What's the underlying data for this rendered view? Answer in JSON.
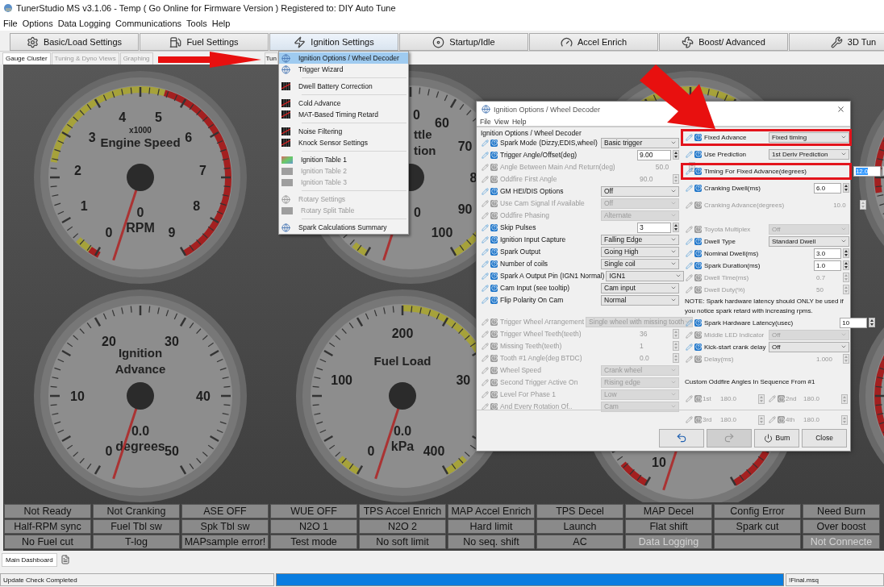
{
  "window": {
    "title": "TunerStudio MS v3.1.06 - Temp ( Go Online for Firmware Version ) Registered to: DIY Auto Tune"
  },
  "menu_bar": [
    "File",
    "Options",
    "Data Logging",
    "Communications",
    "Tools",
    "Help"
  ],
  "toolbar": [
    {
      "label": "Basic/Load Settings",
      "kind": "gear",
      "selected": false
    },
    {
      "label": "Fuel Settings",
      "kind": "fuel",
      "selected": false
    },
    {
      "label": "Ignition Settings",
      "kind": "spark",
      "selected": true
    },
    {
      "label": "Startup/Idle",
      "kind": "disc",
      "selected": false
    },
    {
      "label": "Accel Enrich",
      "kind": "accel",
      "selected": false
    },
    {
      "label": "Boost/ Advanced",
      "kind": "turbo",
      "selected": false
    },
    {
      "label": "3D Tun",
      "kind": "wrench",
      "selected": false
    }
  ],
  "view_tabs": [
    {
      "label": "Gauge Cluster",
      "selected": true,
      "disabled": false
    },
    {
      "label": "Tuning & Dyno Views",
      "selected": false,
      "disabled": true
    },
    {
      "label": "Graphing",
      "selected": false,
      "disabled": true
    },
    {
      "label": "Tun",
      "selected": false,
      "disabled": false
    }
  ],
  "gauges": [
    {
      "kind": "full",
      "multiplier": "x1000",
      "title": [
        "Engine Speed"
      ],
      "scale": [
        "0",
        "1",
        "2",
        "3",
        "4",
        "5",
        "6",
        "7",
        "8",
        "9"
      ],
      "value": "0",
      "unit": "RPM"
    },
    {
      "kind": "tail",
      "title": [
        "ttle",
        "tion"
      ],
      "scale": [
        "0",
        "60",
        "70",
        "8",
        "90",
        "100"
      ],
      "value": "0"
    },
    {
      "kind": "blank"
    },
    {
      "kind": "blank"
    },
    {
      "kind": "full",
      "title": [
        "Ignition",
        "Advance"
      ],
      "scale": [
        "0",
        "10",
        "20",
        "30",
        "40",
        "50"
      ],
      "value": "0.0",
      "unit": "degrees"
    },
    {
      "kind": "full",
      "title": [
        "Fuel Load"
      ],
      "scale": [
        "0",
        "100",
        "200",
        "30",
        "400"
      ],
      "value": "0.0",
      "unit": "kPa"
    },
    {
      "kind": "head",
      "scale": [
        "10"
      ]
    },
    {
      "kind": "blank"
    }
  ],
  "indicators": [
    {
      "kind": "text",
      "label": "Not Ready",
      "dim": false
    },
    {
      "kind": "text",
      "label": "Not Cranking",
      "dim": false
    },
    {
      "kind": "text",
      "label": "ASE OFF",
      "dim": false
    },
    {
      "kind": "text",
      "label": "WUE OFF",
      "dim": false
    },
    {
      "kind": "text",
      "label": "TPS Accel Enrich",
      "dim": false
    },
    {
      "kind": "text",
      "label": "MAP Accel Enrich",
      "dim": false
    },
    {
      "kind": "text",
      "label": "TPS Decel",
      "dim": false
    },
    {
      "kind": "text",
      "label": "MAP Decel",
      "dim": false
    },
    {
      "kind": "text",
      "label": "Config Error",
      "dim": false
    },
    {
      "kind": "text",
      "label": "Need Burn",
      "dim": false
    },
    {
      "kind": "text",
      "label": "Half-RPM sync",
      "dim": false
    },
    {
      "kind": "text",
      "label": "Fuel Tbl sw",
      "dim": false
    },
    {
      "kind": "text",
      "label": "Spk Tbl sw",
      "dim": false
    },
    {
      "kind": "text",
      "label": "N2O 1",
      "dim": false
    },
    {
      "kind": "text",
      "label": "N2O 2",
      "dim": false
    },
    {
      "kind": "text",
      "label": "Hard limit",
      "dim": false
    },
    {
      "kind": "text",
      "label": "Launch",
      "dim": false
    },
    {
      "kind": "text",
      "label": "Flat shift",
      "dim": false
    },
    {
      "kind": "text",
      "label": "Spark cut",
      "dim": false
    },
    {
      "kind": "text",
      "label": "Over boost",
      "dim": false
    },
    {
      "kind": "text",
      "label": "No Fuel cut",
      "dim": false
    },
    {
      "kind": "text",
      "label": "T-log",
      "dim": false
    },
    {
      "kind": "text",
      "label": "MAPsample error!",
      "dim": false
    },
    {
      "kind": "text",
      "label": "Test mode",
      "dim": false
    },
    {
      "kind": "text",
      "label": "No soft limit",
      "dim": false
    },
    {
      "kind": "text",
      "label": "No seq. shift",
      "dim": false
    },
    {
      "kind": "text",
      "label": "AC",
      "dim": false
    },
    {
      "kind": "text",
      "label": "Data Logging",
      "dim": true
    },
    {
      "kind": "blank"
    },
    {
      "kind": "text",
      "label": "Not Connecte",
      "dim": true
    }
  ],
  "bottom_tabs": [
    {
      "label": "Main Dashboard",
      "selected": true
    }
  ],
  "status_bar": {
    "message": "Update Check Completed",
    "progress": {
      "level": 1
    },
    "file": "!Final.msq"
  },
  "ignition_menu": {
    "groups": [
      [
        {
          "label": "Ignition Options / Wheel Decoder",
          "kind": "wizard",
          "selected": true,
          "disabled": false
        },
        {
          "label": "Trigger Wizard",
          "kind": "wizard",
          "selected": false,
          "disabled": false
        }
      ],
      [
        {
          "label": "Dwell Battery Correction",
          "kind": "grid",
          "selected": false,
          "disabled": false
        }
      ],
      [
        {
          "label": "Cold Advance",
          "kind": "grid",
          "selected": false,
          "disabled": false
        },
        {
          "label": "MAT-Based Timing Retard",
          "kind": "grid",
          "selected": false,
          "disabled": false
        }
      ],
      [
        {
          "label": "Noise Filtering",
          "kind": "grid",
          "selected": false,
          "disabled": false
        },
        {
          "label": "Knock Sensor Settings",
          "kind": "grid",
          "selected": false,
          "disabled": false
        }
      ],
      [
        {
          "label": "Ignition Table 1",
          "kind": "table",
          "selected": false,
          "disabled": false
        },
        {
          "label": "Ignition Table 2",
          "kind": "table",
          "selected": false,
          "disabled": true
        },
        {
          "label": "Ignition Table 3",
          "kind": "table",
          "selected": false,
          "disabled": true
        }
      ],
      [
        {
          "label": "Rotary Settings",
          "kind": "wizard",
          "selected": false,
          "disabled": true
        },
        {
          "label": "Rotary Split Table",
          "kind": "table",
          "selected": false,
          "disabled": true
        }
      ],
      [
        {
          "label": "Spark Calculations Summary",
          "kind": "wizard",
          "selected": false,
          "disabled": false
        }
      ]
    ]
  },
  "dialog": {
    "title": "Ignition Options / Wheel Decoder",
    "menu": [
      "File",
      "View",
      "Help"
    ],
    "left": [
      {
        "kind": "heading",
        "text": "Ignition Options / Wheel Decoder"
      },
      {
        "kind": "rows",
        "rows": [
          {
            "label": "Spark Mode (Dizzy,EDIS,wheel)",
            "disabled": false,
            "control": {
              "kind": "select",
              "value": "Basic trigger"
            }
          },
          {
            "label": "Trigger Angle/Offset(deg)",
            "disabled": false,
            "control": {
              "kind": "spin",
              "value": "9.00"
            }
          },
          {
            "label": "Angle Between Main And Return(deg)",
            "disabled": true,
            "control": {
              "kind": "readout",
              "value": "50.0"
            }
          },
          {
            "label": "Oddfire First Angle",
            "disabled": true,
            "control": {
              "kind": "readout",
              "value": "90.0"
            }
          },
          {
            "label": "GM HEI/DIS Options",
            "disabled": false,
            "control": {
              "kind": "select",
              "value": "Off"
            }
          },
          {
            "label": "Use Cam Signal If Available",
            "disabled": true,
            "control": {
              "kind": "select",
              "value": "Off"
            }
          },
          {
            "label": "Oddfire Phasing",
            "disabled": true,
            "control": {
              "kind": "select",
              "value": "Alternate"
            }
          },
          {
            "label": "Skip Pulses",
            "disabled": false,
            "control": {
              "kind": "spin",
              "value": "3"
            }
          },
          {
            "label": "Ignition Input Capture",
            "disabled": false,
            "control": {
              "kind": "select",
              "value": "Falling Edge"
            }
          },
          {
            "label": "Spark Output",
            "disabled": false,
            "control": {
              "kind": "select",
              "value": "Going High"
            }
          },
          {
            "label": "Number of coils",
            "disabled": false,
            "control": {
              "kind": "select",
              "value": "Single coil"
            }
          },
          {
            "label": "Spark A Output Pin (IGN1 Normal)",
            "disabled": false,
            "control": {
              "kind": "select",
              "value": "IGN1"
            }
          },
          {
            "label": "Cam Input (see tooltip)",
            "disabled": false,
            "control": {
              "kind": "select",
              "value": "Cam input"
            }
          },
          {
            "label": "Flip Polarity On Cam",
            "disabled": false,
            "control": {
              "kind": "select",
              "value": "Normal"
            }
          }
        ]
      },
      {
        "kind": "rows",
        "rows": [
          {
            "label": "Trigger Wheel Arrangement",
            "disabled": true,
            "control": {
              "kind": "wide_select",
              "value": "Single wheel with missing tooth"
            }
          },
          {
            "label": "Trigger Wheel Teeth(teeth)",
            "disabled": true,
            "control": {
              "kind": "readout",
              "value": "36"
            }
          },
          {
            "label": "Missing Teeth(teeth)",
            "disabled": true,
            "control": {
              "kind": "readout",
              "value": "1"
            }
          },
          {
            "label": "Tooth #1 Angle(deg BTDC)",
            "disabled": true,
            "control": {
              "kind": "readout",
              "value": "0.0"
            }
          },
          {
            "label": "Wheel Speed",
            "disabled": true,
            "control": {
              "kind": "select",
              "value": "Crank wheel"
            }
          },
          {
            "label": "Second Trigger Active On",
            "disabled": true,
            "control": {
              "kind": "select",
              "value": "Rising edge"
            }
          },
          {
            "label": "Level For Phase 1",
            "disabled": true,
            "control": {
              "kind": "select",
              "value": "Low"
            }
          },
          {
            "label": "And Every Rotation Of..",
            "disabled": true,
            "control": {
              "kind": "select",
              "value": "Cam"
            }
          }
        ]
      }
    ],
    "right": [
      {
        "kind": "rows",
        "rows": [
          {
            "label": "Fixed Advance",
            "disabled": false,
            "framed": true,
            "control": {
              "kind": "select",
              "value": "Fixed timing"
            }
          },
          {
            "label": "Use Prediction",
            "disabled": false,
            "framed": false,
            "control": {
              "kind": "select",
              "value": "1st Deriv Prediction"
            }
          },
          {
            "label": "Timing For Fixed Advance(degrees)",
            "disabled": false,
            "framed": true,
            "control": {
              "kind": "spin",
              "value": "12.0",
              "value_selected": true
            }
          },
          {
            "label": "Cranking Dwell(ms)",
            "disabled": false,
            "framed": false,
            "control": {
              "kind": "spin",
              "value": "6.0",
              "value_selected": false
            }
          },
          {
            "label": "Cranking Advance(degrees)",
            "disabled": true,
            "framed": false,
            "control": {
              "kind": "readout",
              "value": "10.0"
            }
          }
        ]
      },
      {
        "kind": "rows",
        "rows": [
          {
            "label": "Toyota Multiplex",
            "disabled": true,
            "control": {
              "kind": "select",
              "value": "Off"
            }
          },
          {
            "label": "Dwell Type",
            "disabled": false,
            "control": {
              "kind": "select",
              "value": "Standard Dwell"
            }
          },
          {
            "label": "Nominal Dwell(ms)",
            "disabled": false,
            "control": {
              "kind": "spin",
              "value": "3.0"
            }
          },
          {
            "label": "Spark Duration(ms)",
            "disabled": false,
            "control": {
              "kind": "spin",
              "value": "1.0"
            }
          },
          {
            "label": "Dwell Time(ms)",
            "disabled": true,
            "control": {
              "kind": "readout",
              "value": "0.7"
            }
          },
          {
            "label": "Dwell Duty(%)",
            "disabled": true,
            "control": {
              "kind": "readout",
              "value": "50"
            }
          }
        ]
      },
      {
        "kind": "note",
        "text": "NOTE: Spark hardware latency should ONLY be used if you notice spark retard with increasing rpms."
      },
      {
        "kind": "rows",
        "rows": [
          {
            "label": "Spark Hardware Latency(usec)",
            "disabled": false,
            "control": {
              "kind": "spin",
              "value": "10"
            }
          },
          {
            "label": "Middle LED Indicator",
            "disabled": true,
            "control": {
              "kind": "select",
              "value": "Off"
            }
          },
          {
            "label": "Kick-start crank delay",
            "disabled": false,
            "control": {
              "kind": "select",
              "value": "Off"
            }
          },
          {
            "label": "Delay(ms)",
            "disabled": true,
            "control": {
              "kind": "readout",
              "value": "1.000"
            }
          }
        ]
      },
      {
        "kind": "heading",
        "text": "Custom Oddfire Angles In Sequence From #1"
      },
      {
        "kind": "pairs",
        "rows": [
          [
            {
              "label": "1st",
              "value": "180.0",
              "disabled": true
            },
            {
              "label": "2nd",
              "value": "180.0",
              "disabled": true
            }
          ],
          [
            {
              "label": "3rd",
              "value": "180.0",
              "disabled": true
            },
            {
              "label": "4th",
              "value": "180.0",
              "disabled": true
            }
          ]
        ]
      }
    ],
    "buttons": [
      {
        "kind": "undo",
        "disabled": false
      },
      {
        "kind": "redo",
        "disabled": true
      },
      {
        "kind": "burn",
        "label": "Burn",
        "disabled": false
      },
      {
        "kind": "close",
        "label": "Close",
        "disabled": false
      }
    ]
  }
}
